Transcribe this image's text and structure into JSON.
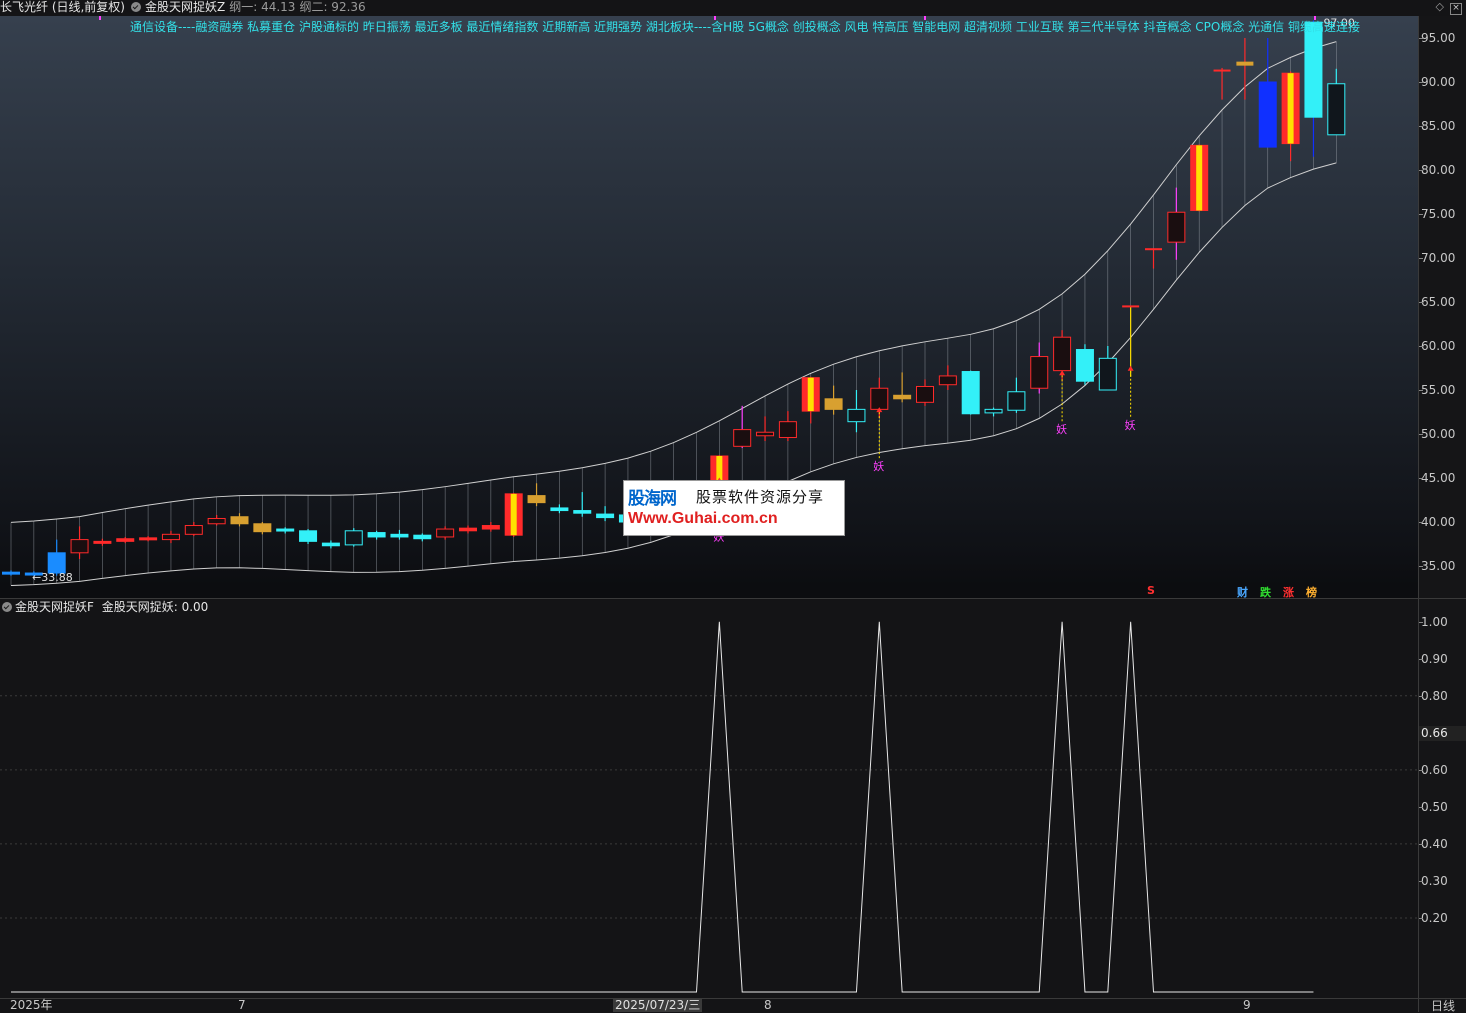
{
  "title_bar": {
    "stock": "长飞光纤 (日线,前复权)",
    "indicator": "金股天网捉妖Z",
    "gang1": "纲一: 44.13",
    "gang2": "纲二: 92.36"
  },
  "concept_line": "通信设备----融资融券 私募重仓 沪股通标的 昨日振荡 最近多板 最近情绪指数 近期新高 近期强势 湖北板块----含H股 5G概念 创投概念 风电 特高压 智能电网 超清视频 工业互联 第三代半导体 抖音概念 CPO概念 光通信 铜缆高速连接",
  "price_axis": {
    "ticks": [
      "95.00",
      "90.00",
      "85.00",
      "80.00",
      "75.00",
      "70.00",
      "65.00",
      "60.00",
      "55.00",
      "50.00",
      "45.00",
      "40.00",
      "35.00"
    ]
  },
  "annotations": {
    "low_price": "←33.88",
    "high_price": "97.00",
    "yao_label": "妖",
    "s_marker": "S",
    "markers": [
      "财",
      "跌",
      "涨",
      "榜"
    ]
  },
  "colors": {
    "up": "#ff2a2a",
    "down": "#33f0f8",
    "gold": "#d8a030",
    "yellow": "#ffe000",
    "magenta": "#ff40ff",
    "blue": "#1030ff",
    "channel": "#d0d0d0"
  },
  "sub_panel": {
    "title": "金股天网捉妖F",
    "value_label": "金股天网捉妖: 0.00",
    "ticks": [
      "1.00",
      "0.90",
      "0.80",
      "0.60",
      "0.50",
      "0.40",
      "0.30",
      "0.20"
    ],
    "current_value": "0.66",
    "signal": [
      0,
      0,
      0,
      0,
      0,
      0,
      0,
      0,
      0,
      0,
      0,
      0,
      0,
      0,
      0,
      0,
      0,
      0,
      0,
      0,
      0,
      0,
      0,
      0,
      0,
      0,
      0,
      0,
      0,
      0,
      0,
      1,
      0,
      0,
      0,
      0,
      0,
      0,
      1,
      0,
      0,
      0,
      0,
      0,
      0,
      0,
      1,
      0,
      0,
      1,
      0,
      0,
      0,
      0,
      0,
      0,
      0,
      0
    ]
  },
  "x_axis": {
    "labels": [
      "2025年",
      "7",
      "8",
      "9"
    ],
    "cursor_date": "2025/07/23/三",
    "period": "日线"
  },
  "watermark": {
    "brand": "股海网",
    "slogan": "股票软件资源分享",
    "url": "Www.Guhai.com.cn"
  },
  "chart_data": {
    "type": "candlestick",
    "ylim": [
      32,
      98
    ],
    "candles": [
      {
        "o": 34.3,
        "c": 34.1,
        "h": 34.5,
        "l": 33.9,
        "t": "blue"
      },
      {
        "o": 34.2,
        "c": 34.0,
        "h": 34.4,
        "l": 33.88,
        "t": "blue"
      },
      {
        "o": 36.5,
        "c": 34.2,
        "h": 38.0,
        "l": 33.9,
        "t": "blue"
      },
      {
        "o": 36.5,
        "c": 38.0,
        "h": 39.5,
        "l": 35.8,
        "t": "upb"
      },
      {
        "o": 37.6,
        "c": 37.8,
        "h": 38.1,
        "l": 37.3,
        "t": "up"
      },
      {
        "o": 37.8,
        "c": 38.1,
        "h": 38.3,
        "l": 37.6,
        "t": "up"
      },
      {
        "o": 38.0,
        "c": 38.2,
        "h": 38.4,
        "l": 37.8,
        "t": "up"
      },
      {
        "o": 38.0,
        "c": 38.6,
        "h": 39.0,
        "l": 37.6,
        "t": "upb"
      },
      {
        "o": 38.6,
        "c": 39.6,
        "h": 40.0,
        "l": 38.4,
        "t": "upb"
      },
      {
        "o": 39.8,
        "c": 40.4,
        "h": 40.8,
        "l": 39.6,
        "t": "upb"
      },
      {
        "o": 40.6,
        "c": 39.8,
        "h": 41.0,
        "l": 39.5,
        "t": "gold"
      },
      {
        "o": 39.8,
        "c": 38.9,
        "h": 40.0,
        "l": 38.6,
        "t": "gold"
      },
      {
        "o": 39.2,
        "c": 39.0,
        "h": 39.4,
        "l": 38.7,
        "t": "down"
      },
      {
        "o": 39.0,
        "c": 37.8,
        "h": 39.2,
        "l": 37.5,
        "t": "down"
      },
      {
        "o": 37.6,
        "c": 37.3,
        "h": 37.9,
        "l": 37.0,
        "t": "down"
      },
      {
        "o": 37.4,
        "c": 39.0,
        "h": 39.3,
        "l": 37.2,
        "t": "downh"
      },
      {
        "o": 38.8,
        "c": 38.3,
        "h": 39.0,
        "l": 38.0,
        "t": "down"
      },
      {
        "o": 38.6,
        "c": 38.3,
        "h": 39.1,
        "l": 38.0,
        "t": "down"
      },
      {
        "o": 38.5,
        "c": 38.1,
        "h": 38.7,
        "l": 37.8,
        "t": "down"
      },
      {
        "o": 38.3,
        "c": 39.2,
        "h": 39.5,
        "l": 38.0,
        "t": "upb"
      },
      {
        "o": 39.0,
        "c": 39.3,
        "h": 39.6,
        "l": 38.7,
        "t": "up"
      },
      {
        "o": 39.2,
        "c": 39.6,
        "h": 40.0,
        "l": 38.9,
        "t": "up"
      },
      {
        "o": 38.5,
        "c": 43.2,
        "h": 43.3,
        "l": 38.3,
        "t": "ry"
      },
      {
        "o": 42.2,
        "c": 43.0,
        "h": 44.4,
        "l": 41.8,
        "t": "gold"
      },
      {
        "o": 41.6,
        "c": 41.3,
        "h": 42.0,
        "l": 41.0,
        "t": "down"
      },
      {
        "o": 41.3,
        "c": 41.0,
        "h": 43.4,
        "l": 40.6,
        "t": "down"
      },
      {
        "o": 40.9,
        "c": 40.5,
        "h": 41.8,
        "l": 40.1,
        "t": "down"
      },
      {
        "o": 40.8,
        "c": 40.0,
        "h": 41.3,
        "l": 39.7,
        "t": "down"
      },
      {
        "o": 40.2,
        "c": 39.8,
        "h": 40.6,
        "l": 39.5,
        "t": "down"
      },
      {
        "o": 40.0,
        "c": 40.5,
        "h": 41.0,
        "l": 39.6,
        "t": "downh"
      },
      {
        "o": 40.5,
        "c": 40.8,
        "h": 41.2,
        "l": 40.0,
        "t": "down"
      },
      {
        "o": 44.0,
        "c": 47.5,
        "h": 47.6,
        "l": 43.8,
        "t": "ry"
      },
      {
        "o": 48.6,
        "c": 50.5,
        "h": 53.2,
        "l": 48.4,
        "t": "upb",
        "hc": "magenta"
      },
      {
        "o": 49.8,
        "c": 50.2,
        "h": 52.0,
        "l": 49.2,
        "t": "upb"
      },
      {
        "o": 49.6,
        "c": 51.4,
        "h": 52.6,
        "l": 49.2,
        "t": "upb"
      },
      {
        "o": 52.6,
        "c": 56.4,
        "h": 56.5,
        "l": 51.2,
        "t": "ry"
      },
      {
        "o": 54.0,
        "c": 52.8,
        "h": 55.5,
        "l": 52.2,
        "t": "gold"
      },
      {
        "o": 51.4,
        "c": 52.8,
        "h": 55.0,
        "l": 50.2,
        "t": "downh"
      },
      {
        "o": 52.8,
        "c": 55.2,
        "h": 56.4,
        "l": 51.8,
        "t": "upb"
      },
      {
        "o": 54.0,
        "c": 54.4,
        "h": 57.0,
        "l": 53.6,
        "t": "gold"
      },
      {
        "o": 53.6,
        "c": 55.4,
        "h": 56.2,
        "l": 53.2,
        "t": "upb"
      },
      {
        "o": 55.6,
        "c": 56.6,
        "h": 57.8,
        "l": 55.0,
        "t": "upb"
      },
      {
        "o": 57.1,
        "c": 52.3,
        "h": 57.2,
        "l": 52.2,
        "t": "down"
      },
      {
        "o": 52.8,
        "c": 52.4,
        "h": 53.0,
        "l": 52.0,
        "t": "downh"
      },
      {
        "o": 52.7,
        "c": 54.8,
        "h": 56.4,
        "l": 52.4,
        "t": "downh"
      },
      {
        "o": 55.2,
        "c": 58.8,
        "h": 60.4,
        "l": 54.6,
        "t": "upb",
        "hc": "magenta"
      },
      {
        "o": 57.2,
        "c": 61.0,
        "h": 61.8,
        "l": 56.0,
        "t": "upb"
      },
      {
        "o": 59.6,
        "c": 56.0,
        "h": 60.2,
        "l": 55.6,
        "t": "down"
      },
      {
        "o": 55.0,
        "c": 58.6,
        "h": 60.0,
        "l": 55.0,
        "t": "downh"
      },
      {
        "o": 64.5,
        "c": 64.5,
        "h": 64.6,
        "l": 56.5,
        "t": "tick",
        "hc": "yellow"
      },
      {
        "o": 71.0,
        "c": 71.0,
        "h": 71.1,
        "l": 68.8,
        "t": "tick"
      },
      {
        "o": 71.8,
        "c": 75.2,
        "h": 78.0,
        "l": 69.8,
        "t": "upb",
        "hc": "magenta"
      },
      {
        "o": 75.4,
        "c": 82.8,
        "h": 82.9,
        "l": 75.3,
        "t": "ry"
      },
      {
        "o": 91.3,
        "c": 91.3,
        "h": 91.6,
        "l": 88.0,
        "t": "tick"
      },
      {
        "o": 92.2,
        "c": 92.2,
        "h": 95.0,
        "l": 88.0,
        "t": "tick",
        "c2": "gold"
      },
      {
        "o": 90.0,
        "c": 82.6,
        "h": 95.0,
        "l": 82.6,
        "t": "blue2"
      },
      {
        "o": 83.0,
        "c": 91.0,
        "h": 91.2,
        "l": 81.0,
        "t": "ry"
      },
      {
        "o": 96.8,
        "c": 86.0,
        "h": 97.0,
        "l": 81.5,
        "t": "cyanbig"
      },
      {
        "o": 84.0,
        "c": 89.8,
        "h": 91.5,
        "l": 84.0,
        "t": "downh"
      }
    ]
  }
}
